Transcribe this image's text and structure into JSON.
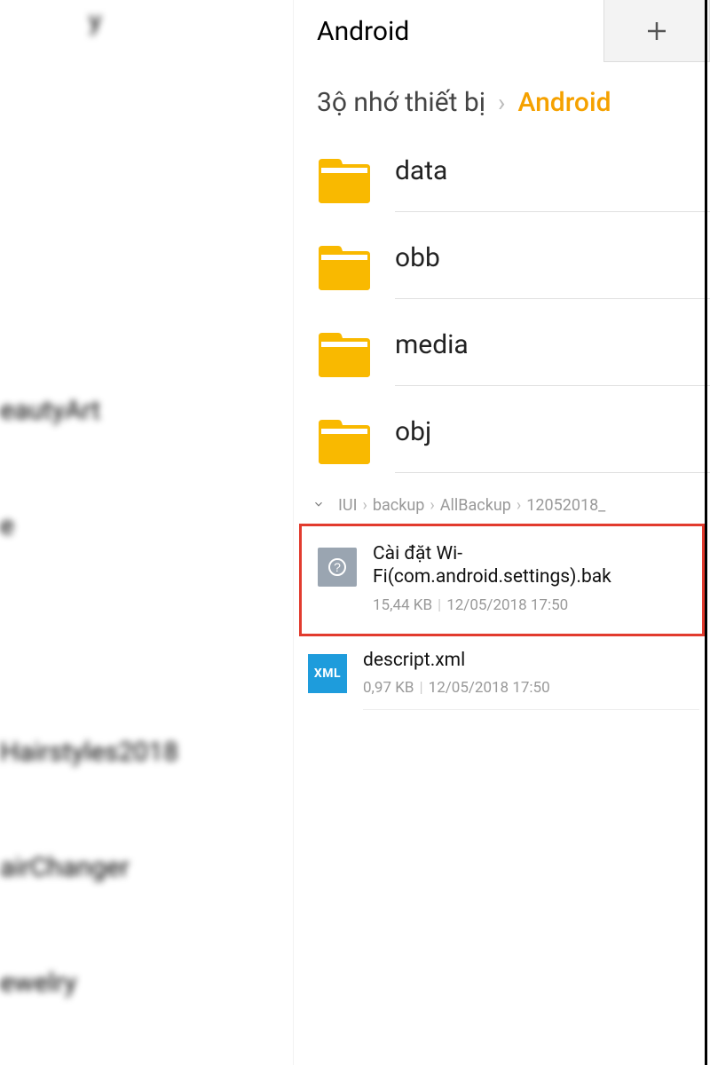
{
  "left_panel": {
    "items": [
      "eautyArt",
      "Hairstyles2018",
      "airChanger",
      "ewelry"
    ],
    "extra_char": "e"
  },
  "tab": {
    "label": "Android"
  },
  "breadcrumb_top": {
    "parent": "3ộ nhớ thiết bị",
    "current": "Android"
  },
  "folders": [
    {
      "name": "data"
    },
    {
      "name": "obb"
    },
    {
      "name": "media"
    },
    {
      "name": "obj"
    }
  ],
  "breadcrumb_path": [
    "IUI",
    "backup",
    "AllBackup",
    "12052018_"
  ],
  "files": [
    {
      "name": "Cài đặt Wi-Fi(com.android.settings).bak",
      "size": "15,44 KB",
      "date": "12/05/2018 17:50",
      "type": "bak",
      "highlighted": true
    },
    {
      "name": "descript.xml",
      "size": "0,97 KB",
      "date": "12/05/2018 17:50",
      "type": "xml",
      "highlighted": false
    }
  ],
  "xml_label": "XML"
}
